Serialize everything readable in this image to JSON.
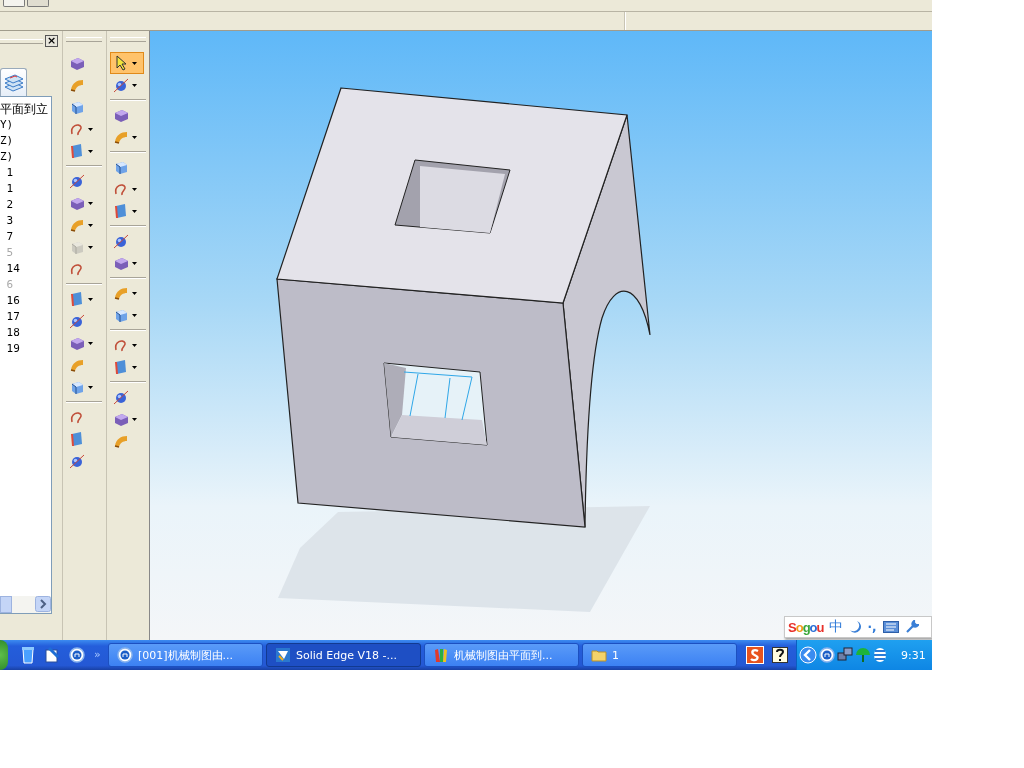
{
  "tree_panel": {
    "close": "×",
    "items": [
      {
        "label": "平面到立",
        "disabled": false
      },
      {
        "label": "Y)",
        "disabled": false
      },
      {
        "label": "Z)",
        "disabled": false
      },
      {
        "label": "Z)",
        "disabled": false
      },
      {
        "label": " 1",
        "disabled": false
      },
      {
        "label": " 1",
        "disabled": false
      },
      {
        "label": " 2",
        "disabled": false
      },
      {
        "label": " 3",
        "disabled": false
      },
      {
        "label": " 7",
        "disabled": false
      },
      {
        "label": " 5",
        "disabled": true
      },
      {
        "label": " 14",
        "disabled": false
      },
      {
        "label": " 6",
        "disabled": true
      },
      {
        "label": " 16",
        "disabled": false
      },
      {
        "label": " 17",
        "disabled": false
      },
      {
        "label": " 18",
        "disabled": false
      },
      {
        "label": " 19",
        "disabled": false
      }
    ]
  },
  "toolbars": [
    {
      "groups": [
        [
          {
            "dropdown": false,
            "disabled": false
          },
          {
            "dropdown": false,
            "disabled": false
          },
          {
            "dropdown": false,
            "disabled": false
          },
          {
            "dropdown": true,
            "disabled": false
          },
          {
            "dropdown": true,
            "disabled": false
          }
        ],
        [
          {
            "dropdown": false,
            "disabled": false
          },
          {
            "dropdown": true,
            "disabled": false
          },
          {
            "dropdown": true,
            "disabled": false
          },
          {
            "dropdown": true,
            "disabled": true
          },
          {
            "dropdown": false,
            "disabled": false
          }
        ],
        [
          {
            "dropdown": true,
            "disabled": false
          },
          {
            "dropdown": false,
            "disabled": false
          },
          {
            "dropdown": true,
            "disabled": false
          },
          {
            "dropdown": false,
            "disabled": false
          },
          {
            "dropdown": true,
            "disabled": false
          }
        ],
        [
          {
            "dropdown": false,
            "disabled": false
          },
          {
            "dropdown": false,
            "disabled": false
          },
          {
            "dropdown": false,
            "disabled": false
          }
        ]
      ]
    },
    {
      "groups": [
        [
          {
            "dropdown": true,
            "selected": true
          },
          {
            "dropdown": true,
            "selected": false
          }
        ],
        [
          {
            "dropdown": false,
            "selected": false
          },
          {
            "dropdown": true,
            "selected": false
          }
        ],
        [
          {
            "dropdown": false,
            "selected": false
          },
          {
            "dropdown": true,
            "selected": false
          },
          {
            "dropdown": true,
            "selected": false
          }
        ],
        [
          {
            "dropdown": false,
            "selected": false
          },
          {
            "dropdown": true,
            "selected": false
          }
        ],
        [
          {
            "dropdown": true,
            "selected": false
          },
          {
            "dropdown": true,
            "selected": false
          }
        ],
        [
          {
            "dropdown": true,
            "selected": false
          },
          {
            "dropdown": true,
            "selected": false
          }
        ],
        [
          {
            "dropdown": false,
            "selected": false
          },
          {
            "dropdown": true,
            "selected": false
          },
          {
            "dropdown": false,
            "selected": false
          }
        ]
      ]
    }
  ],
  "ime_bar": {
    "logo": "Sogou",
    "mode": "中",
    "punct": "·,"
  },
  "taskbar": {
    "overflow": "»",
    "tasks": [
      {
        "label": "[001]机械制图由...",
        "selected": false
      },
      {
        "label": "Solid Edge V18 -...",
        "selected": true
      },
      {
        "label": "机械制图由平面到...",
        "selected": false
      },
      {
        "label": "1",
        "selected": false
      }
    ],
    "clock": "9:31"
  }
}
